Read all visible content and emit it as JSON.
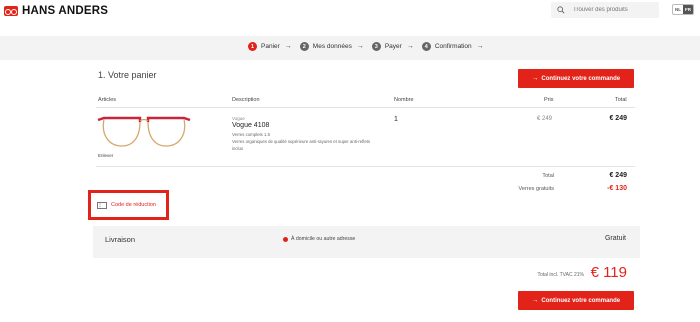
{
  "header": {
    "brand": "HANS ANDERS",
    "search_placeholder": "Trouver des produits",
    "lang": [
      "NL",
      "FR"
    ],
    "lang_active": "FR"
  },
  "steps": [
    {
      "num": "1",
      "label": "Panier"
    },
    {
      "num": "2",
      "label": "Mes données"
    },
    {
      "num": "3",
      "label": "Payer"
    },
    {
      "num": "4",
      "label": "Confirmation"
    }
  ],
  "cart": {
    "title": "1. Votre panier",
    "continue_label": "Continuez votre commande",
    "columns": {
      "articles": "Articles",
      "description": "Description",
      "quantity": "Nombre",
      "price": "Prix",
      "total": "Total"
    },
    "item": {
      "brand": "Vogue",
      "name": "Vogue 4108",
      "desc_lines": [
        "Verres complets 1.5",
        "Verres organiques de qualité supérieure anti-rayures et super anti-reflets",
        "inclus"
      ],
      "remove": "Enlever",
      "quantity": "1",
      "price": "€ 249",
      "total": "€ 249"
    },
    "summary": {
      "total_label": "Total",
      "total_value": "€ 249",
      "discount_label": "Verres gratuits",
      "discount_value": "-€ 130"
    },
    "coupon_label": "Code de réduction",
    "delivery": {
      "title": "Livraison",
      "option": "À domicile ou autre adresse",
      "cost": "Gratuit"
    },
    "grand_total_label": "Total incl. TVAC 21%",
    "grand_total_value": "€ 119"
  },
  "colors": {
    "accent": "#e2231a",
    "band": "#f3f3f3"
  }
}
